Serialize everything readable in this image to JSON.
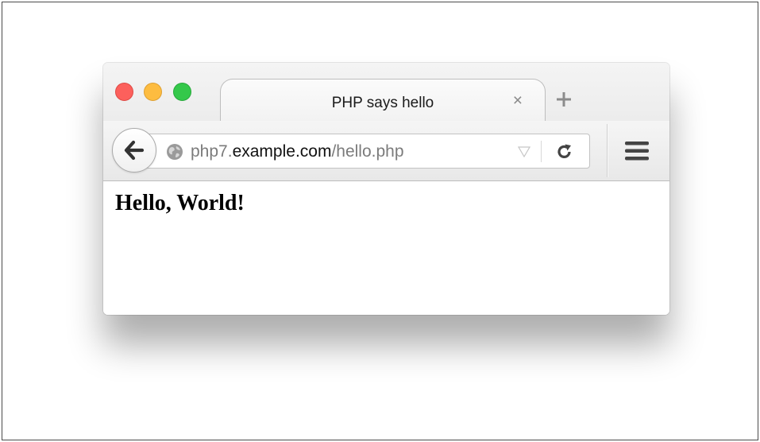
{
  "colors": {
    "close": "#fc605c",
    "minimize": "#fdbc40",
    "maximize": "#34c84a"
  },
  "window": {
    "traffic_lights": [
      "close",
      "minimize",
      "maximize"
    ]
  },
  "tab": {
    "title": "PHP says hello",
    "close_icon": "×",
    "new_tab_icon": "plus-icon"
  },
  "navbar": {
    "back_icon": "back-arrow-icon",
    "site_icon": "globe-icon",
    "url": {
      "prefix": "php7.",
      "domain": "example.com",
      "path": "/hello.php"
    },
    "dropmarker_icon": "dropdown-triangle-icon",
    "reload_icon": "reload-icon",
    "menu_icon": "hamburger-menu-icon"
  },
  "page": {
    "heading": "Hello, World!"
  }
}
